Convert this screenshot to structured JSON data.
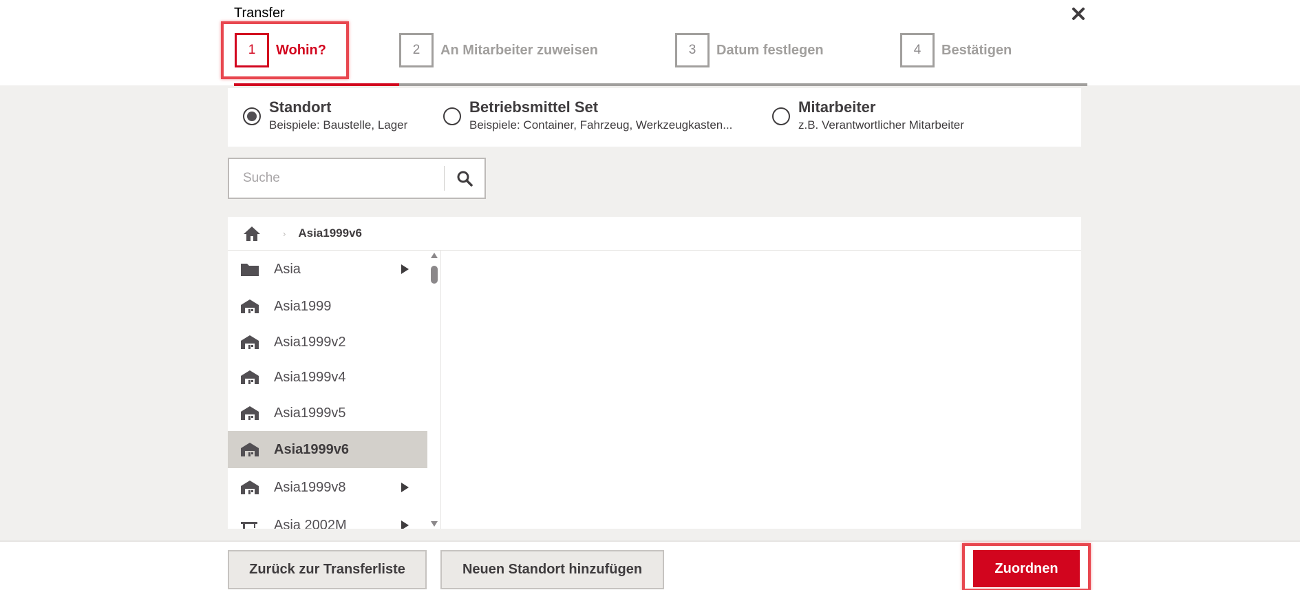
{
  "dialog": {
    "title": "Transfer",
    "close_icon": "close-icon"
  },
  "steps": [
    {
      "number": "1",
      "label": "Wohin?",
      "active": true
    },
    {
      "number": "2",
      "label": "An Mitarbeiter zuweisen",
      "active": false
    },
    {
      "number": "3",
      "label": "Datum festlegen",
      "active": false
    },
    {
      "number": "4",
      "label": "Bestätigen",
      "active": false
    }
  ],
  "target_types": [
    {
      "title": "Standort",
      "subtitle": "Beispiele: Baustelle, Lager",
      "selected": true
    },
    {
      "title": "Betriebsmittel Set",
      "subtitle": "Beispiele: Container, Fahrzeug, Werkzeugkasten...",
      "selected": false
    },
    {
      "title": "Mitarbeiter",
      "subtitle": "z.B. Verantwortlicher Mitarbeiter",
      "selected": false
    }
  ],
  "search": {
    "placeholder": "Suche",
    "value": "",
    "icon": "search-icon"
  },
  "breadcrumb": {
    "home_icon": "home-icon",
    "current": "Asia1999v6"
  },
  "locations": [
    {
      "label": "Asia",
      "icon": "folder-icon",
      "has_children": true,
      "selected": false
    },
    {
      "label": "Asia1999",
      "icon": "warehouse-icon",
      "has_children": false,
      "selected": false
    },
    {
      "label": "Asia1999v2",
      "icon": "warehouse-icon",
      "has_children": false,
      "selected": false
    },
    {
      "label": "Asia1999v4",
      "icon": "warehouse-icon",
      "has_children": false,
      "selected": false
    },
    {
      "label": "Asia1999v5",
      "icon": "warehouse-icon",
      "has_children": false,
      "selected": false
    },
    {
      "label": "Asia1999v6",
      "icon": "warehouse-icon",
      "has_children": false,
      "selected": true
    },
    {
      "label": "Asia1999v8",
      "icon": "warehouse-icon",
      "has_children": true,
      "selected": false
    },
    {
      "label": "Asia 2002M",
      "icon": "crane-icon",
      "has_children": true,
      "selected": false
    }
  ],
  "footer": {
    "back_label": "Zurück zur Transferliste",
    "add_location_label": "Neuen Standort hinzufügen",
    "assign_label": "Zuordnen"
  },
  "colors": {
    "accent": "#d2051e",
    "highlight": "#e8474f",
    "background": "#f1f0ee"
  }
}
